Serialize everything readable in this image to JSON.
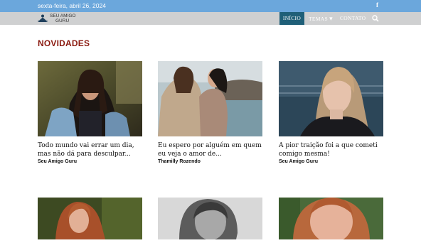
{
  "topbar": {
    "date": "sexta-feira, abril 26, 2024",
    "social_icon": "f"
  },
  "logo": {
    "line1": "SEU AMIGO",
    "line2": "GURU"
  },
  "nav": {
    "home": "INÍCIO",
    "temas": "TEMAS",
    "temas_arrow": "▾",
    "contato": "CONTATO",
    "search_icon": "search-icon"
  },
  "section": {
    "title": "NOVIDADES"
  },
  "posts": [
    {
      "title": "Todo mundo vai errar um dia, mas não dá para desculpar...",
      "author": "Seu Amigo Guru"
    },
    {
      "title": "Eu espero por alguém em quem eu veja o amor de...",
      "author": "Thamilly Rozendo"
    },
    {
      "title": "A pior traição foi a que cometi comigo mesma!",
      "author": "Seu Amigo Guru"
    },
    {
      "title": "",
      "author": ""
    },
    {
      "title": "",
      "author": ""
    },
    {
      "title": "",
      "author": ""
    }
  ]
}
